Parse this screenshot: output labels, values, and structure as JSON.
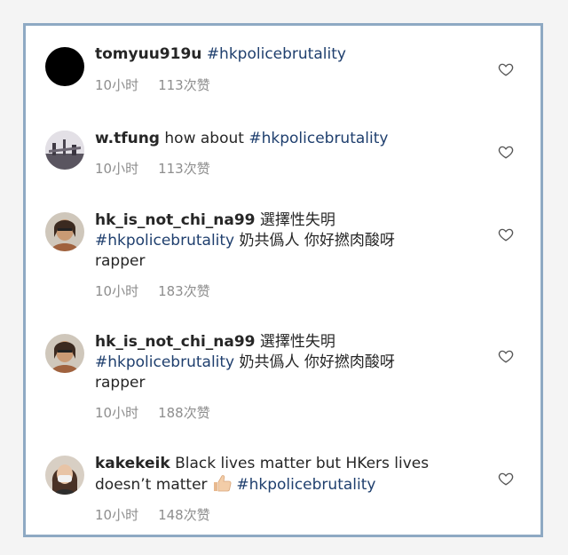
{
  "colors": {
    "frame_border": "#8ea9c3",
    "hashtag": "#1f3f6e",
    "meta_text": "#8e8e8e",
    "body_text": "#262626"
  },
  "comments": [
    {
      "username": "tomyuu919u",
      "text": "",
      "hashtag": "#hkpolicebrutality",
      "text_after": "",
      "line2": "",
      "time": "10小时",
      "likes": "113次赞",
      "avatar_icon": "black-circle-avatar",
      "action_icon": "heart-icon"
    },
    {
      "username": "w.tfung",
      "text": "how about",
      "hashtag": "#hkpolicebrutality",
      "text_after": "",
      "line2": "",
      "time": "10小时",
      "likes": "113次赞",
      "avatar_icon": "photo-avatar",
      "action_icon": "heart-icon"
    },
    {
      "username": "hk_is_not_chi_na99",
      "text": "選擇性失明",
      "hashtag": "#hkpolicebrutality",
      "text_after": "奶共僞人 你好撚肉酸呀",
      "line2": "rapper",
      "time": "10小时",
      "likes": "183次赞",
      "avatar_icon": "photo-avatar",
      "action_icon": "heart-icon"
    },
    {
      "username": "hk_is_not_chi_na99",
      "text": "選擇性失明",
      "hashtag": "#hkpolicebrutality",
      "text_after": "奶共僞人 你好撚肉酸呀",
      "line2": "rapper",
      "time": "10小时",
      "likes": "188次赞",
      "avatar_icon": "photo-avatar",
      "action_icon": "heart-icon"
    },
    {
      "username": "kakekeik",
      "text": "Black lives matter but HKers lives",
      "text2": "doesn’t matter",
      "emoji_icon": "thumbs-up-emoji",
      "hashtag": "#hkpolicebrutality",
      "time": "10小时",
      "likes": "148次赞",
      "avatar_icon": "photo-avatar",
      "action_icon": "heart-icon"
    }
  ]
}
